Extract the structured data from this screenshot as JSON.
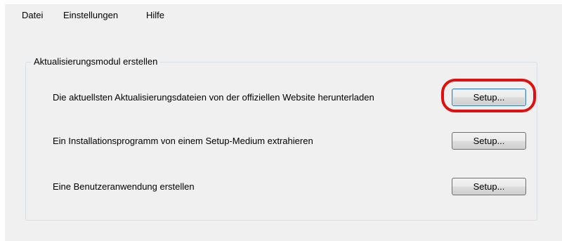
{
  "menubar": {
    "items": [
      {
        "label": "Datei"
      },
      {
        "label": "Einstellungen"
      },
      {
        "label": "Hilfe"
      }
    ]
  },
  "group": {
    "title": "Aktualisierungsmodul erstellen",
    "rows": [
      {
        "label": "Die aktuellsten Aktualisierungsdateien von der offiziellen Website herunterladen",
        "button": "Setup..."
      },
      {
        "label": "Ein Installationsprogramm von einem Setup-Medium extrahieren",
        "button": "Setup..."
      },
      {
        "label": "Eine Benutzeranwendung erstellen",
        "button": "Setup..."
      }
    ]
  },
  "colors": {
    "window_bg": "#f0f0f0",
    "highlight": "#e01010"
  }
}
